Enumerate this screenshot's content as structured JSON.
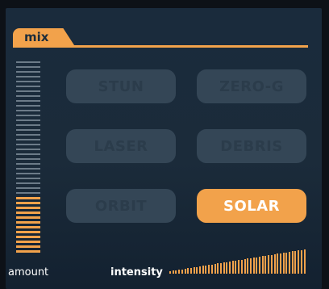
{
  "panel": {
    "tab_label": "mix",
    "accent_color": "#f2a24b"
  },
  "meter": {
    "label": "amount",
    "level_fraction": 0.3
  },
  "buttons": [
    {
      "label": "STUN",
      "active": false
    },
    {
      "label": "ZERO-G",
      "active": false
    },
    {
      "label": "LASER",
      "active": false
    },
    {
      "label": "DEBRIS",
      "active": false
    },
    {
      "label": "ORBIT",
      "active": false
    },
    {
      "label": "SOLAR",
      "active": true
    }
  ],
  "intensity": {
    "label": "intensity",
    "level_fraction": 1.0
  }
}
